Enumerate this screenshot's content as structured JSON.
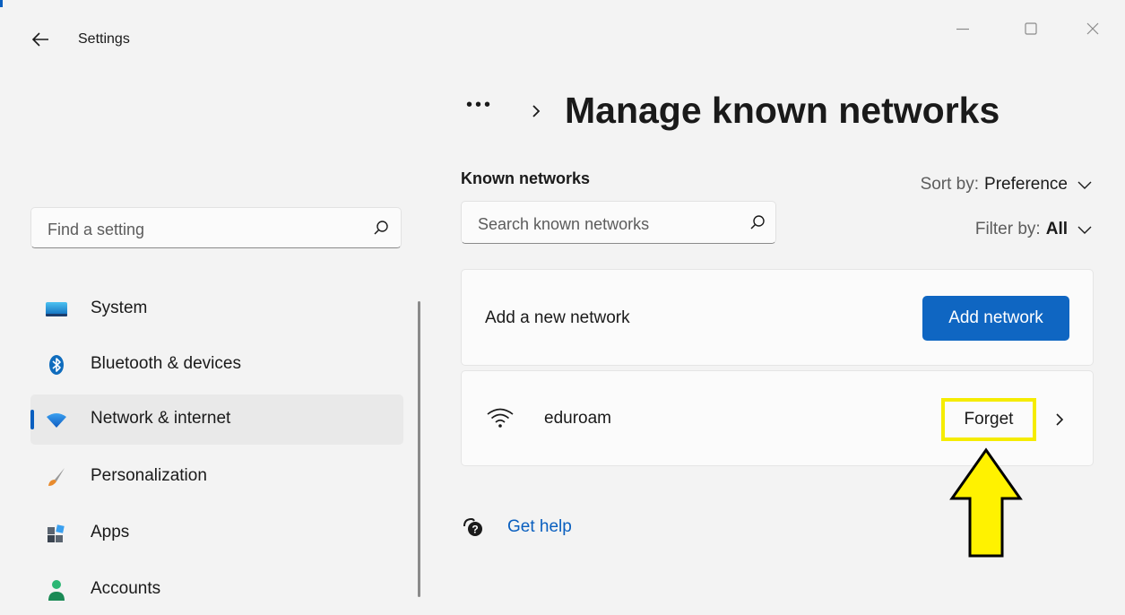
{
  "window": {
    "title": "Settings",
    "back_icon": "back-arrow-icon",
    "controls": [
      "minimize-icon",
      "maximize-icon",
      "close-icon"
    ]
  },
  "sidebar": {
    "search": {
      "placeholder": "Find a setting",
      "icon": "search-icon"
    },
    "items": [
      {
        "label": "System",
        "icon": "system-monitor-icon",
        "selected": false
      },
      {
        "label": "Bluetooth & devices",
        "icon": "bluetooth-icon",
        "selected": false
      },
      {
        "label": "Network & internet",
        "icon": "wifi-diamond-icon",
        "selected": true
      },
      {
        "label": "Personalization",
        "icon": "paintbrush-icon",
        "selected": false
      },
      {
        "label": "Apps",
        "icon": "apps-icon",
        "selected": false
      },
      {
        "label": "Accounts",
        "icon": "person-icon",
        "selected": false
      }
    ]
  },
  "main": {
    "breadcrumb": {
      "overflow": "•••",
      "separator_icon": "chevron-right-icon"
    },
    "title": "Manage known networks",
    "section_title": "Known networks",
    "search": {
      "placeholder": "Search known networks",
      "icon": "search-icon"
    },
    "sort": {
      "label": "Sort by:",
      "value": "Preference"
    },
    "filter": {
      "label": "Filter by:",
      "value": "All"
    },
    "add_card": {
      "label": "Add a new network",
      "button": "Add network"
    },
    "networks": [
      {
        "name": "eduroam",
        "icon": "wifi-icon",
        "action": "Forget",
        "highlighted": true
      }
    ],
    "help": {
      "label": "Get help",
      "icon": "help-icon"
    }
  },
  "colors": {
    "background": "#f3f3f3",
    "card": "#fbfbfb",
    "accent": "#0f66c2",
    "highlight": "#f5ec00",
    "link": "#0a5fbf"
  }
}
